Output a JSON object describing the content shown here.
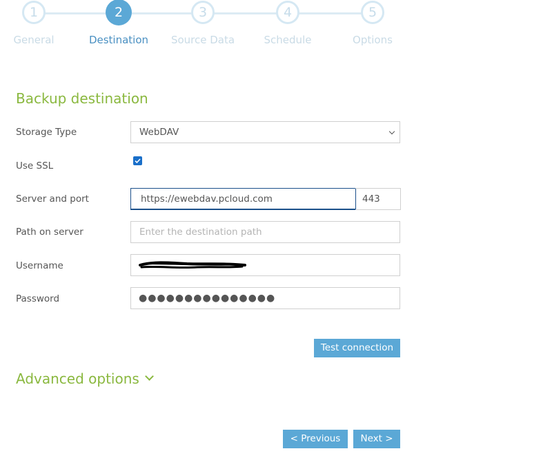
{
  "wizard": {
    "steps": [
      {
        "number": "1",
        "label": "General"
      },
      {
        "number": "2",
        "label": "Destination"
      },
      {
        "number": "3",
        "label": "Source Data"
      },
      {
        "number": "4",
        "label": "Schedule"
      },
      {
        "number": "5",
        "label": "Options"
      }
    ],
    "active_step": 2
  },
  "form": {
    "title": "Backup destination",
    "storage_type": {
      "label": "Storage Type",
      "value": "WebDAV"
    },
    "use_ssl": {
      "label": "Use SSL",
      "checked": true
    },
    "server": {
      "label": "Server and port",
      "value": "https://ewebdav.pcloud.com",
      "port": "443"
    },
    "path": {
      "label": "Path on server",
      "value": "",
      "placeholder": "Enter the destination path"
    },
    "username": {
      "label": "Username",
      "value": ""
    },
    "password": {
      "label": "Password",
      "value": "●●●●●●●●●●●●●●●"
    }
  },
  "buttons": {
    "test_connection": "Test connection",
    "previous": "< Previous",
    "next": "Next >"
  },
  "advanced": {
    "label": "Advanced options"
  },
  "colors": {
    "accent_green": "#8ab83f",
    "accent_blue": "#5ba8d6"
  }
}
